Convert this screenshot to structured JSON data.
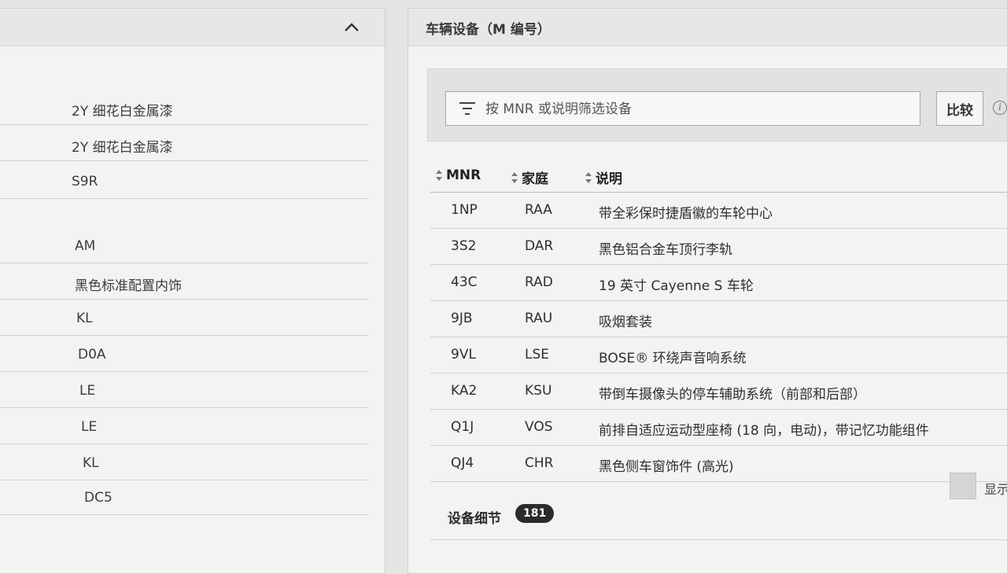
{
  "left_panel": {
    "rows": [
      "2Y 细花白金属漆",
      "2Y 细花白金属漆",
      "S9R",
      "AM",
      "黑色标准配置内饰",
      "KL",
      "D0A",
      "LE",
      "LE",
      "KL",
      "DC5"
    ]
  },
  "right_panel": {
    "title": "车辆设备（M 编号）",
    "filter": {
      "placeholder": "按 MNR 或说明筛选设备",
      "value": ""
    },
    "compare_label": "比较",
    "info_glyph": "i",
    "columns": {
      "mnr": "MNR",
      "family": "家庭",
      "description": "说明"
    },
    "rows": [
      {
        "mnr": "1NP",
        "family": "RAA",
        "description": "带全彩保时捷盾徽的车轮中心"
      },
      {
        "mnr": "3S2",
        "family": "DAR",
        "description": "黑色铝合金车顶行李轨"
      },
      {
        "mnr": "43C",
        "family": "RAD",
        "description": "19 英寸 Cayenne S 车轮"
      },
      {
        "mnr": "9JB",
        "family": "RAU",
        "description": "吸烟套装"
      },
      {
        "mnr": "9VL",
        "family": "LSE",
        "description": "BOSE® 环绕声音响系统"
      },
      {
        "mnr": "KA2",
        "family": "KSU",
        "description": "带倒车摄像头的停车辅助系统（前部和后部）"
      },
      {
        "mnr": "Q1J",
        "family": "VOS",
        "description": "前排自适应运动型座椅 (18 向，电动)，带记忆功能组件"
      },
      {
        "mnr": "QJ4",
        "family": "CHR",
        "description": "黑色侧车窗饰件 (高光)"
      }
    ],
    "details": {
      "label": "设备细节",
      "count": "181"
    },
    "show_label": "显示"
  },
  "colors": {
    "badge": "#2b2b2b",
    "panel": "#f3f3f1",
    "header": "#e7e7e5"
  },
  "icons": {
    "collapse": "chevron-up-icon",
    "filter": "filter-icon",
    "sort": "sort-icon",
    "info": "info-icon"
  }
}
